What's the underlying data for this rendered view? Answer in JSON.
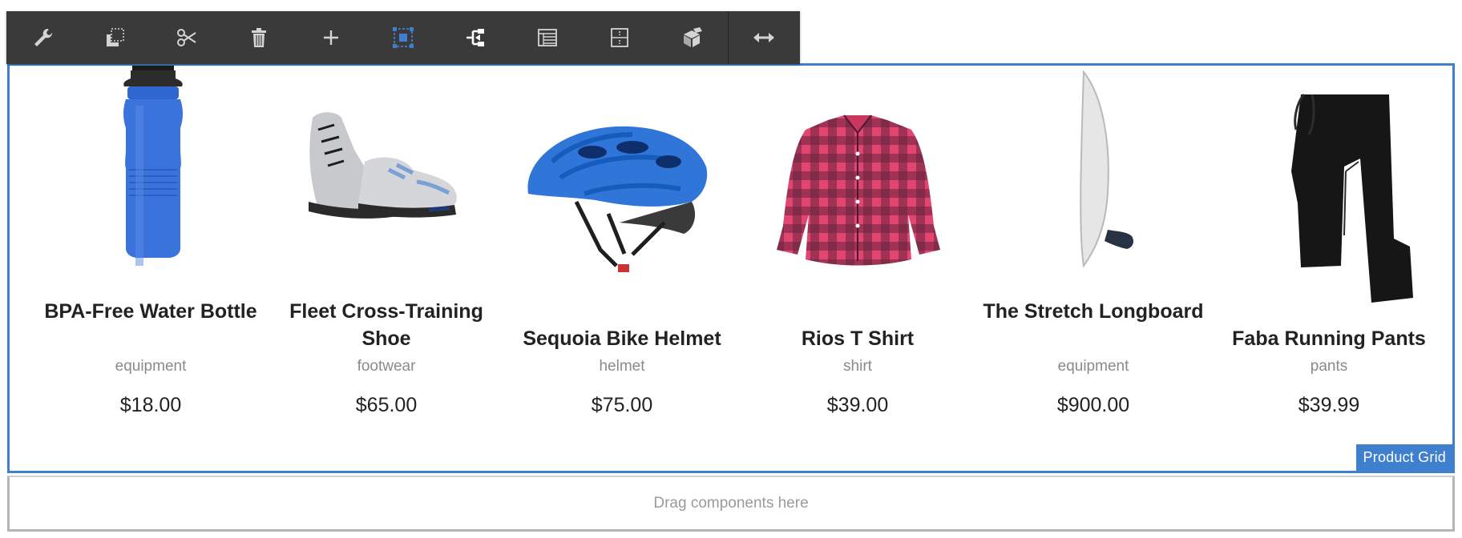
{
  "toolbar": {
    "icons": [
      "wrench-icon",
      "copy-icon",
      "cut-icon",
      "trash-icon",
      "plus-icon",
      "select-parent-icon",
      "structure-icon",
      "layout-icon",
      "grid-layout-icon",
      "package-icon",
      "resize-icon"
    ]
  },
  "component": {
    "label": "Product Grid"
  },
  "products": [
    {
      "name": "BPA-Free Water Bottle",
      "category": "equipment",
      "price": "$18.00"
    },
    {
      "name": "Fleet Cross-Training Shoe",
      "category": "footwear",
      "price": "$65.00"
    },
    {
      "name": "Sequoia Bike Helmet",
      "category": "helmet",
      "price": "$75.00"
    },
    {
      "name": "Rios T Shirt",
      "category": "shirt",
      "price": "$39.00"
    },
    {
      "name": "The Stretch Longboard",
      "category": "equipment",
      "price": "$900.00"
    },
    {
      "name": "Faba Running Pants",
      "category": "pants",
      "price": "$39.99"
    }
  ],
  "dropzone": {
    "text": "Drag components here"
  },
  "colors": {
    "accent": "#3e7fce",
    "toolbar_bg": "#3a3a3a",
    "icon": "#d4d4d4"
  }
}
